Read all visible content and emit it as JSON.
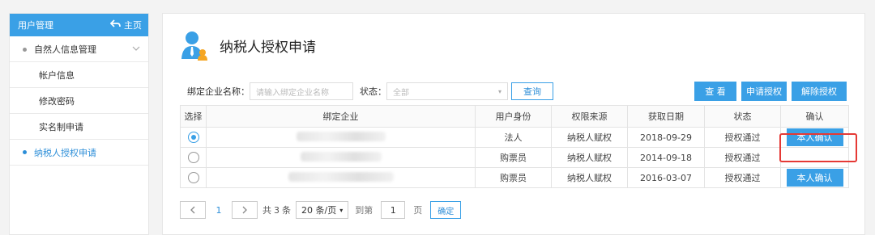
{
  "sidebar": {
    "title": "用户管理",
    "home_label": "主页",
    "items": [
      {
        "label": "自然人信息管理"
      },
      {
        "label": "帐户信息"
      },
      {
        "label": "修改密码"
      },
      {
        "label": "实名制申请"
      },
      {
        "label": "纳税人授权申请"
      }
    ]
  },
  "page": {
    "title": "纳税人授权申请"
  },
  "filter": {
    "company_label": "绑定企业名称：",
    "company_placeholder": "请输入绑定企业名称",
    "status_label": "状态：",
    "status_value": "全部",
    "search_label": "查询"
  },
  "actions": {
    "view": "查 看",
    "apply": "申请授权",
    "revoke": "解除授权"
  },
  "table": {
    "headers": [
      "选择",
      "绑定企业",
      "用户身份",
      "权限来源",
      "获取日期",
      "状态",
      "确认"
    ],
    "rows": [
      {
        "checked": true,
        "identity": "法人",
        "source": "纳税人赋权",
        "date": "2018-09-29",
        "status": "授权通过",
        "confirm": "本人确认"
      },
      {
        "checked": false,
        "identity": "购票员",
        "source": "纳税人赋权",
        "date": "2014-09-18",
        "status": "授权通过",
        "confirm": ""
      },
      {
        "checked": false,
        "identity": "购票员",
        "source": "纳税人赋权",
        "date": "2016-03-07",
        "status": "授权通过",
        "confirm": "本人确认"
      }
    ]
  },
  "pager": {
    "page": "1",
    "total_prefix": "共",
    "total_count": "3",
    "total_suffix": "条",
    "page_size": "20 条/页",
    "goto_label": "到第",
    "goto_value": "1",
    "page_unit": "页",
    "ok_label": "确定"
  },
  "colors": {
    "accent": "#3aa0e6",
    "highlight": "#e53935"
  }
}
